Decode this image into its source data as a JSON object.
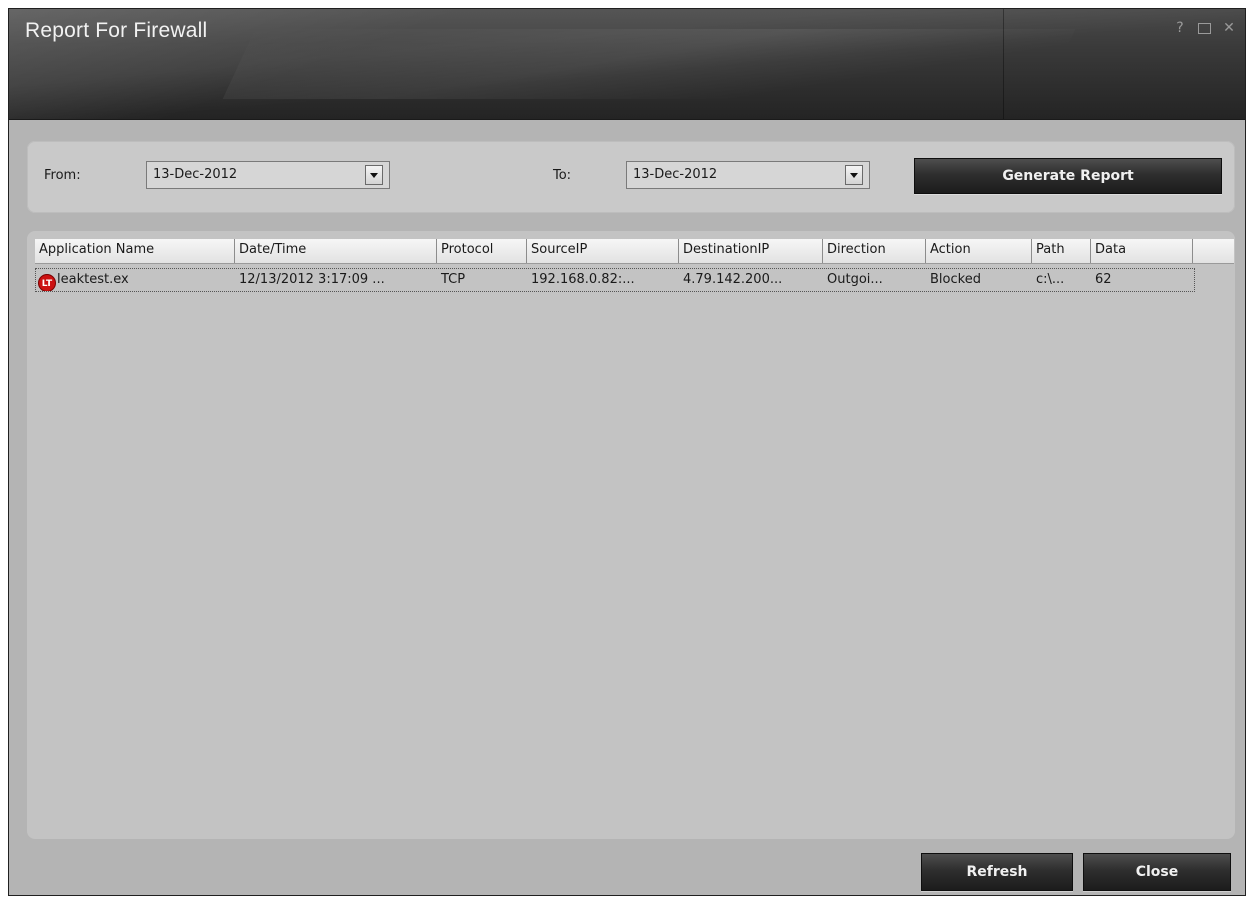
{
  "window": {
    "title": "Report For Firewall",
    "controls": {
      "help": "?",
      "close": "✕"
    }
  },
  "filters": {
    "from_label": "From:",
    "from_value": "13-Dec-2012",
    "to_label": "To:",
    "to_value": "13-Dec-2012",
    "generate_label": "Generate Report"
  },
  "table": {
    "columns": [
      "Application Name",
      "Date/Time",
      "Protocol",
      "SourceIP",
      "DestinationIP",
      "Direction",
      "Action",
      "Path",
      "Data"
    ],
    "rows": [
      {
        "icon": "LT",
        "app": "leaktest.ex",
        "datetime": "12/13/2012 3:17:09 ...",
        "protocol": "TCP",
        "source": "192.168.0.82:...",
        "destination": "4.79.142.200...",
        "direction": "Outgoi...",
        "action": "Blocked",
        "path": "c:\\...",
        "data": "62"
      }
    ]
  },
  "footer": {
    "refresh_label": "Refresh",
    "close_label": "Close"
  },
  "colors": {
    "titlebar": "#333333",
    "body": "#b4b4b4",
    "panel": "#c9c9c9",
    "button": "#2e2e2e",
    "icon_red": "#cc1111"
  }
}
